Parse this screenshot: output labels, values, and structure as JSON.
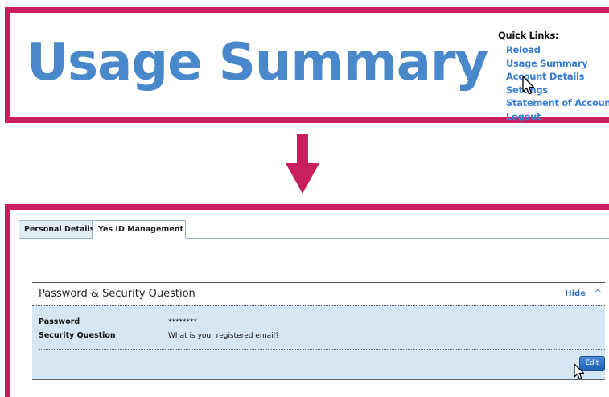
{
  "top": {
    "title": "Usage Summary",
    "quick_links": {
      "heading": "Quick Links:",
      "items": [
        "Reload",
        "Usage Summary",
        "Account Details",
        "Settings",
        "Statement of Account",
        "Logout"
      ]
    }
  },
  "bottom": {
    "tabs": [
      "Personal Details",
      "Yes ID Management"
    ],
    "section": {
      "title": "Password & Security Question",
      "hide_label": "Hide",
      "chevron": "^",
      "rows": [
        {
          "label": "Password",
          "value": "********"
        },
        {
          "label": "Security Question",
          "value": "What is your registered email?"
        }
      ],
      "edit_label": "Edit"
    }
  },
  "colors": {
    "frame": "#c8205f",
    "title_blue": "#4a88cc",
    "link_blue": "#3a7fd0",
    "panel_bg": "#d5e6f5"
  },
  "icons": [
    "mouse-pointer-icon",
    "down-arrow-icon",
    "chevron-up-icon"
  ]
}
